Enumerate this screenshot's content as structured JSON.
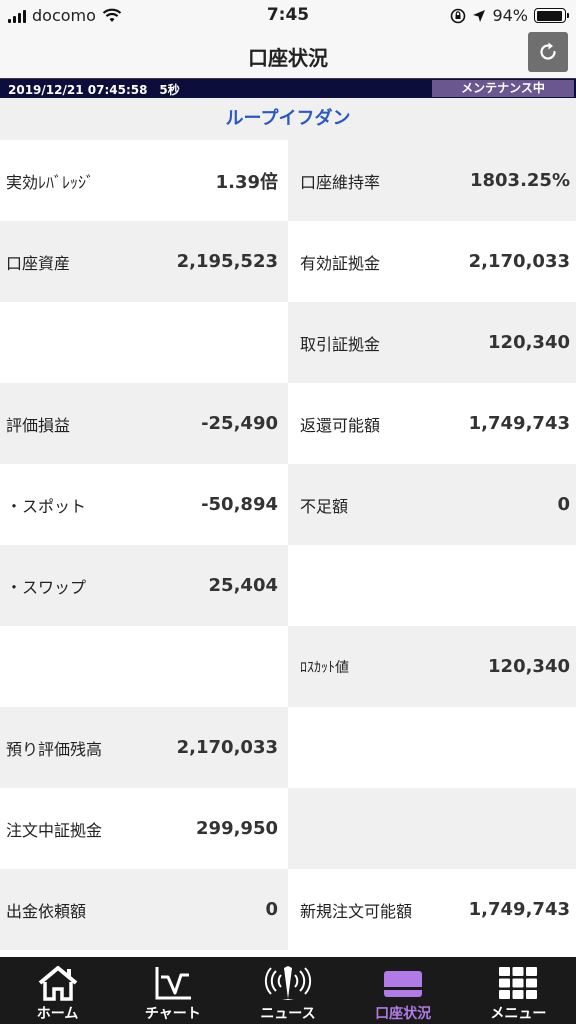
{
  "status_bar": {
    "carrier": "docomo",
    "time": "7:45",
    "battery": "94%",
    "battery_level": 0.94
  },
  "header": {
    "title": "口座状況",
    "refresh_icon": "refresh-icon"
  },
  "info": {
    "datetime": "2019/12/21 07:45:58　5秒",
    "maintenance": "メンテナンス中"
  },
  "section": {
    "title": "ループイフダン"
  },
  "left_cells": [
    {
      "label": "実効ﾚﾊﾞﾚｯｼﾞ",
      "value": "1.39倍"
    },
    {
      "label": "口座資産",
      "value": "2,195,523"
    },
    {
      "label": "",
      "value": ""
    },
    {
      "label": "評価損益",
      "value": "-25,490"
    },
    {
      "label": "・スポット",
      "value": "-50,894"
    },
    {
      "label": "・スワップ",
      "value": "25,404"
    },
    {
      "label": "",
      "value": ""
    },
    {
      "label": "預り評価残高",
      "value": "2,170,033"
    },
    {
      "label": "注文中証拠金",
      "value": "299,950"
    },
    {
      "label": "出金依頼額",
      "value": "0"
    }
  ],
  "right_cells": [
    {
      "label": "口座維持率",
      "value": "1803.25%"
    },
    {
      "label": "有効証拠金",
      "value": "2,170,033"
    },
    {
      "label": "取引証拠金",
      "value": "120,340"
    },
    {
      "label": "返還可能額",
      "value": "1,749,743"
    },
    {
      "label": "不足額",
      "value": "0"
    },
    {
      "label": "",
      "value": ""
    },
    {
      "label": "ﾛｽｶｯﾄ値",
      "value": "120,340"
    },
    {
      "label": "",
      "value": ""
    },
    {
      "label": "",
      "value": ""
    },
    {
      "label": "新規注文可能額",
      "value": "1,749,743"
    }
  ],
  "tabs": [
    {
      "label": "ホーム",
      "icon": "home-icon"
    },
    {
      "label": "チャート",
      "icon": "chart-icon"
    },
    {
      "label": "ニュース",
      "icon": "news-icon"
    },
    {
      "label": "口座状況",
      "icon": "account-icon",
      "active": true
    },
    {
      "label": "メニュー",
      "icon": "menu-icon"
    }
  ],
  "colors": {
    "info_strip": "#0c0d3b",
    "maintenance_badge": "#6a5790",
    "section_title": "#2a58c4",
    "active_tab": "#b07be6",
    "tabbar": "#1a1a1a"
  }
}
